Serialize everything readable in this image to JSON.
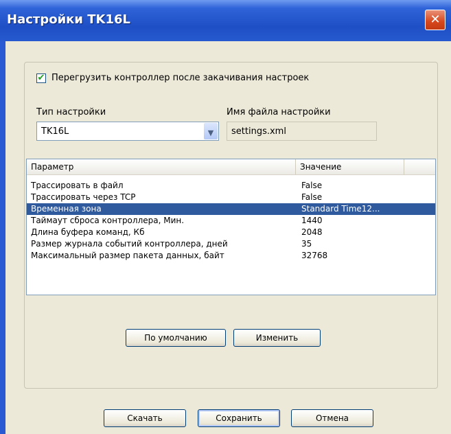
{
  "window": {
    "title": "Настройки TK16L",
    "close_glyph": "✕"
  },
  "reboot_checkbox": {
    "label": "Перегрузить контроллер после закачивания настроек",
    "checked": true
  },
  "settings_type": {
    "label": "Тип настройки",
    "value": "TK16L"
  },
  "settings_file": {
    "label": "Имя файла настройки",
    "value": "settings.xml"
  },
  "params_table": {
    "headers": [
      "Параметр",
      "Значение"
    ],
    "rows": [
      {
        "param": "Трассировать в файл",
        "value": "False"
      },
      {
        "param": "Трассировать через TCP",
        "value": "False"
      },
      {
        "param": "Временная зона",
        "value": "Standard Time12...",
        "selected": true
      },
      {
        "param": "Таймаут сброса контроллера, Мин.",
        "value": "1440"
      },
      {
        "param": "Длина буфера команд, Кб",
        "value": "2048"
      },
      {
        "param": "Размер журнала событий контроллера, дней",
        "value": "35"
      },
      {
        "param": "Максимальный размер пакета данных, байт",
        "value": "32768"
      }
    ]
  },
  "inner_buttons": {
    "defaults": "По умолчанию",
    "change": "Изменить"
  },
  "footer_buttons": {
    "download": "Скачать",
    "save": "Сохранить",
    "cancel": "Отмена"
  },
  "colors": {
    "titlebar": "#2f63d8",
    "selection": "#2f5a9e",
    "dialog_bg": "#ece9d8"
  }
}
